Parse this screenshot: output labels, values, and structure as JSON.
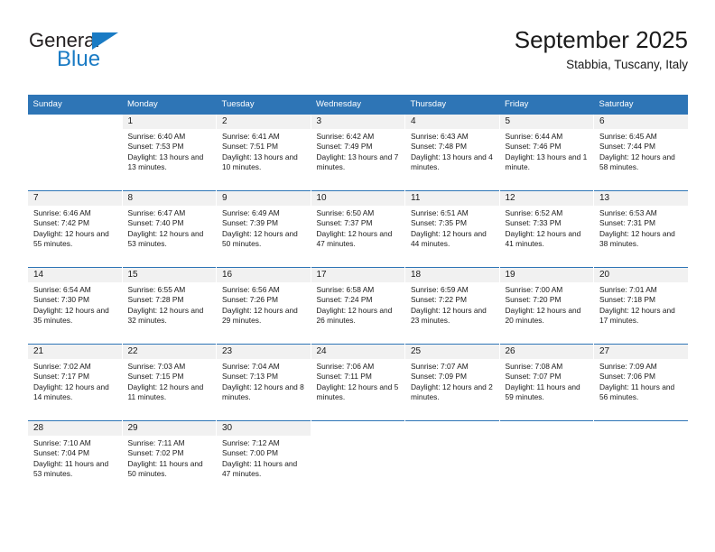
{
  "brand": {
    "name_top": "General",
    "name_bottom": "Blue",
    "triangle_icon": "triangle-icon",
    "color_dark": "#231f20",
    "color_blue": "#1a7bc4"
  },
  "header": {
    "title": "September 2025",
    "subtitle": "Stabbia, Tuscany, Italy"
  },
  "theme": {
    "header_blue": "#2e75b6",
    "daynum_band": "#f1f1f1",
    "text": "#1a1a1a"
  },
  "weekday_headers": [
    "Sunday",
    "Monday",
    "Tuesday",
    "Wednesday",
    "Thursday",
    "Friday",
    "Saturday"
  ],
  "weeks": [
    [
      {
        "day": "",
        "sunrise": "",
        "sunset": "",
        "daylight": ""
      },
      {
        "day": "1",
        "sunrise": "Sunrise: 6:40 AM",
        "sunset": "Sunset: 7:53 PM",
        "daylight": "Daylight: 13 hours and 13 minutes."
      },
      {
        "day": "2",
        "sunrise": "Sunrise: 6:41 AM",
        "sunset": "Sunset: 7:51 PM",
        "daylight": "Daylight: 13 hours and 10 minutes."
      },
      {
        "day": "3",
        "sunrise": "Sunrise: 6:42 AM",
        "sunset": "Sunset: 7:49 PM",
        "daylight": "Daylight: 13 hours and 7 minutes."
      },
      {
        "day": "4",
        "sunrise": "Sunrise: 6:43 AM",
        "sunset": "Sunset: 7:48 PM",
        "daylight": "Daylight: 13 hours and 4 minutes."
      },
      {
        "day": "5",
        "sunrise": "Sunrise: 6:44 AM",
        "sunset": "Sunset: 7:46 PM",
        "daylight": "Daylight: 13 hours and 1 minute."
      },
      {
        "day": "6",
        "sunrise": "Sunrise: 6:45 AM",
        "sunset": "Sunset: 7:44 PM",
        "daylight": "Daylight: 12 hours and 58 minutes."
      }
    ],
    [
      {
        "day": "7",
        "sunrise": "Sunrise: 6:46 AM",
        "sunset": "Sunset: 7:42 PM",
        "daylight": "Daylight: 12 hours and 55 minutes."
      },
      {
        "day": "8",
        "sunrise": "Sunrise: 6:47 AM",
        "sunset": "Sunset: 7:40 PM",
        "daylight": "Daylight: 12 hours and 53 minutes."
      },
      {
        "day": "9",
        "sunrise": "Sunrise: 6:49 AM",
        "sunset": "Sunset: 7:39 PM",
        "daylight": "Daylight: 12 hours and 50 minutes."
      },
      {
        "day": "10",
        "sunrise": "Sunrise: 6:50 AM",
        "sunset": "Sunset: 7:37 PM",
        "daylight": "Daylight: 12 hours and 47 minutes."
      },
      {
        "day": "11",
        "sunrise": "Sunrise: 6:51 AM",
        "sunset": "Sunset: 7:35 PM",
        "daylight": "Daylight: 12 hours and 44 minutes."
      },
      {
        "day": "12",
        "sunrise": "Sunrise: 6:52 AM",
        "sunset": "Sunset: 7:33 PM",
        "daylight": "Daylight: 12 hours and 41 minutes."
      },
      {
        "day": "13",
        "sunrise": "Sunrise: 6:53 AM",
        "sunset": "Sunset: 7:31 PM",
        "daylight": "Daylight: 12 hours and 38 minutes."
      }
    ],
    [
      {
        "day": "14",
        "sunrise": "Sunrise: 6:54 AM",
        "sunset": "Sunset: 7:30 PM",
        "daylight": "Daylight: 12 hours and 35 minutes."
      },
      {
        "day": "15",
        "sunrise": "Sunrise: 6:55 AM",
        "sunset": "Sunset: 7:28 PM",
        "daylight": "Daylight: 12 hours and 32 minutes."
      },
      {
        "day": "16",
        "sunrise": "Sunrise: 6:56 AM",
        "sunset": "Sunset: 7:26 PM",
        "daylight": "Daylight: 12 hours and 29 minutes."
      },
      {
        "day": "17",
        "sunrise": "Sunrise: 6:58 AM",
        "sunset": "Sunset: 7:24 PM",
        "daylight": "Daylight: 12 hours and 26 minutes."
      },
      {
        "day": "18",
        "sunrise": "Sunrise: 6:59 AM",
        "sunset": "Sunset: 7:22 PM",
        "daylight": "Daylight: 12 hours and 23 minutes."
      },
      {
        "day": "19",
        "sunrise": "Sunrise: 7:00 AM",
        "sunset": "Sunset: 7:20 PM",
        "daylight": "Daylight: 12 hours and 20 minutes."
      },
      {
        "day": "20",
        "sunrise": "Sunrise: 7:01 AM",
        "sunset": "Sunset: 7:18 PM",
        "daylight": "Daylight: 12 hours and 17 minutes."
      }
    ],
    [
      {
        "day": "21",
        "sunrise": "Sunrise: 7:02 AM",
        "sunset": "Sunset: 7:17 PM",
        "daylight": "Daylight: 12 hours and 14 minutes."
      },
      {
        "day": "22",
        "sunrise": "Sunrise: 7:03 AM",
        "sunset": "Sunset: 7:15 PM",
        "daylight": "Daylight: 12 hours and 11 minutes."
      },
      {
        "day": "23",
        "sunrise": "Sunrise: 7:04 AM",
        "sunset": "Sunset: 7:13 PM",
        "daylight": "Daylight: 12 hours and 8 minutes."
      },
      {
        "day": "24",
        "sunrise": "Sunrise: 7:06 AM",
        "sunset": "Sunset: 7:11 PM",
        "daylight": "Daylight: 12 hours and 5 minutes."
      },
      {
        "day": "25",
        "sunrise": "Sunrise: 7:07 AM",
        "sunset": "Sunset: 7:09 PM",
        "daylight": "Daylight: 12 hours and 2 minutes."
      },
      {
        "day": "26",
        "sunrise": "Sunrise: 7:08 AM",
        "sunset": "Sunset: 7:07 PM",
        "daylight": "Daylight: 11 hours and 59 minutes."
      },
      {
        "day": "27",
        "sunrise": "Sunrise: 7:09 AM",
        "sunset": "Sunset: 7:06 PM",
        "daylight": "Daylight: 11 hours and 56 minutes."
      }
    ],
    [
      {
        "day": "28",
        "sunrise": "Sunrise: 7:10 AM",
        "sunset": "Sunset: 7:04 PM",
        "daylight": "Daylight: 11 hours and 53 minutes."
      },
      {
        "day": "29",
        "sunrise": "Sunrise: 7:11 AM",
        "sunset": "Sunset: 7:02 PM",
        "daylight": "Daylight: 11 hours and 50 minutes."
      },
      {
        "day": "30",
        "sunrise": "Sunrise: 7:12 AM",
        "sunset": "Sunset: 7:00 PM",
        "daylight": "Daylight: 11 hours and 47 minutes."
      },
      {
        "day": "",
        "sunrise": "",
        "sunset": "",
        "daylight": ""
      },
      {
        "day": "",
        "sunrise": "",
        "sunset": "",
        "daylight": ""
      },
      {
        "day": "",
        "sunrise": "",
        "sunset": "",
        "daylight": ""
      },
      {
        "day": "",
        "sunrise": "",
        "sunset": "",
        "daylight": ""
      }
    ]
  ]
}
